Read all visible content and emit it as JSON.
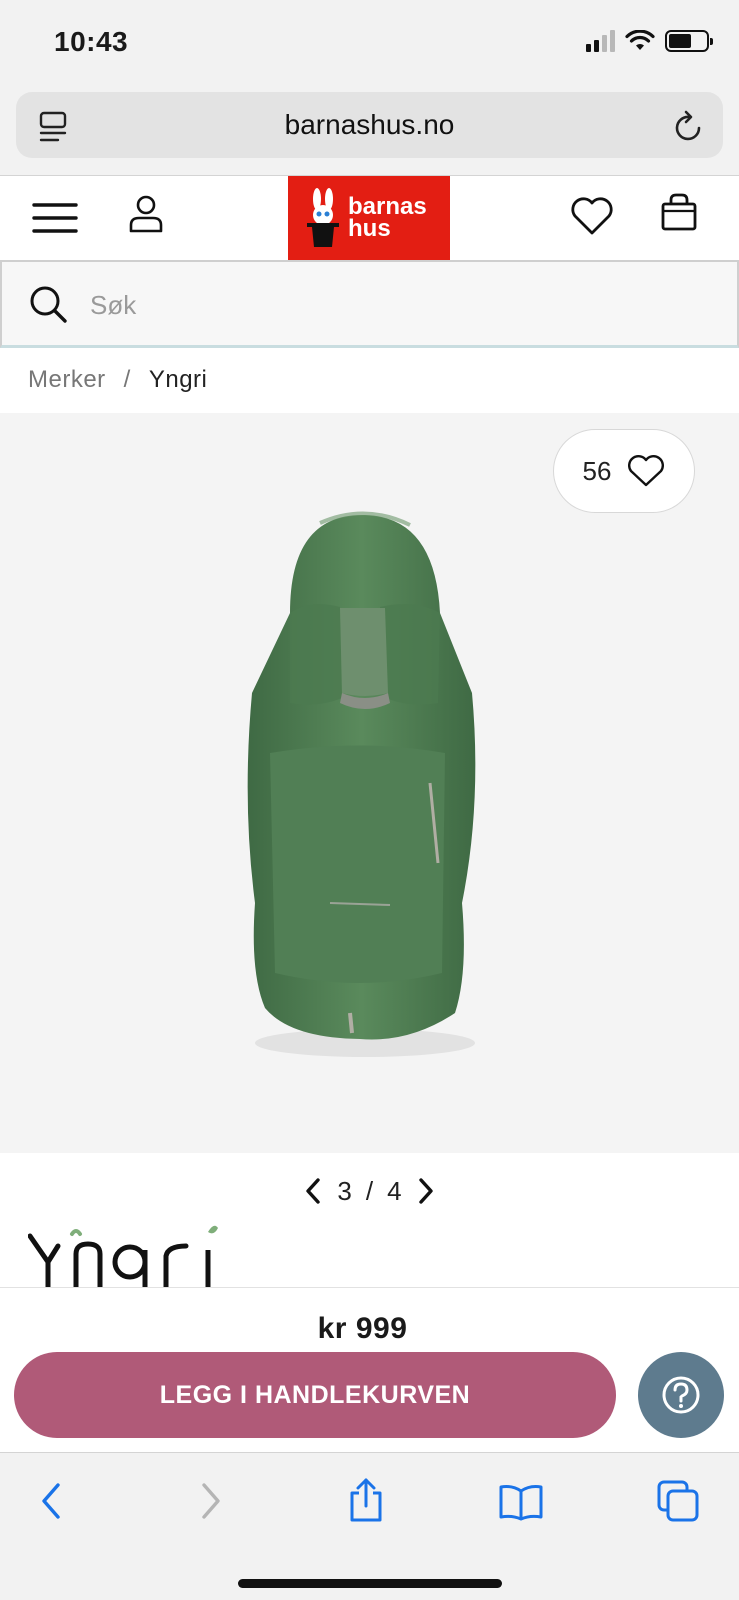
{
  "status_bar": {
    "time": "10:43"
  },
  "browser": {
    "url": "barnashus.no"
  },
  "header": {
    "logo_line1": "barnas",
    "logo_line2": "hus"
  },
  "search": {
    "placeholder": "Søk"
  },
  "breadcrumb": {
    "items": [
      "Merker",
      "Yngri"
    ],
    "separator": "/"
  },
  "product": {
    "likes": "56",
    "image_current": "3",
    "image_separator": "/",
    "image_total": "4",
    "brand": "Yngri",
    "price": "kr 999",
    "add_to_cart": "LEGG I HANDLEKURVEN",
    "product_color": "#4f7a52"
  },
  "colors": {
    "brand_red": "#e31e13",
    "cart_button": "#b05a78",
    "help_button": "#5e7b8e",
    "safari_blue": "#1a73e8"
  },
  "icons": [
    "reader-icon",
    "reload-icon",
    "menu-icon",
    "user-icon",
    "heart-icon",
    "bag-icon",
    "search-icon",
    "chevron-left-icon",
    "chevron-right-icon",
    "question-icon",
    "back-icon",
    "forward-icon",
    "share-icon",
    "bookmarks-icon",
    "tabs-icon"
  ]
}
